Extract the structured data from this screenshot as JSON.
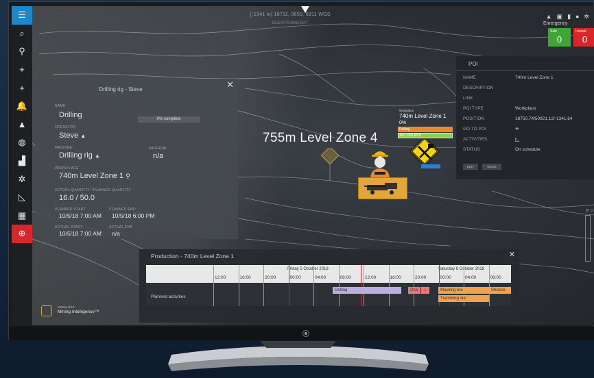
{
  "header": {
    "coordinates": "[-1341 m] 18711, 0650, 5811 WGS",
    "sub_coords": "ELEVATION/LIGHT"
  },
  "top_icons": [
    "warning-icon",
    "screen-icon",
    "battery-icon",
    "user-icon",
    "settings-icon"
  ],
  "emergency": {
    "title": "Emergency",
    "safe_label": "Safe",
    "safe_count": "0",
    "unsafe_label": "Unsafe",
    "unsafe_count": "0",
    "safe_color": "#3fa535",
    "unsafe_color": "#d8262b"
  },
  "sidebar": {
    "items": [
      {
        "name": "menu-icon",
        "glyph": "☰"
      },
      {
        "name": "search-icon",
        "glyph": "⌕"
      },
      {
        "name": "location-pin-icon",
        "glyph": "⚲"
      },
      {
        "name": "route-icon",
        "glyph": "⌖"
      },
      {
        "name": "add-icon",
        "glyph": "+"
      },
      {
        "name": "bell-icon",
        "glyph": "🔔"
      },
      {
        "name": "warning-icon",
        "glyph": "▲"
      },
      {
        "name": "globe-icon",
        "glyph": "◍"
      },
      {
        "name": "analytics-icon",
        "glyph": "▟"
      },
      {
        "name": "settings-icon",
        "glyph": "✲"
      },
      {
        "name": "chart-icon",
        "glyph": "◺"
      },
      {
        "name": "grid-icon",
        "glyph": "▦"
      },
      {
        "name": "alarm-icon",
        "glyph": "⊕"
      }
    ]
  },
  "drilling_panel": {
    "title": "Drilling rig - Steve",
    "name_label": "NAME",
    "name_value": "Drilling",
    "progress_text": "0% complete",
    "progress_fraction": 0,
    "operator_label": "OPERATOR",
    "operator_value": "Steve",
    "machine_label": "MACHINE",
    "machine_value": "Drilling rig",
    "material_label": "MATERIAL",
    "material_value": "n/a",
    "workplace_label": "WORKPLACE",
    "workplace_value": "740m Level Zone 1",
    "quantity_label": "ACTUAL QUANTITY / PLANNED QUANTITY",
    "quantity_value": "16.0 / 50.0",
    "planned_start_label": "PLANNED START",
    "planned_start_value": "10/5/18 7:00 AM",
    "planned_end_label": "PLANNED END",
    "planned_end_value": "10/5/18 6:00 PM",
    "actual_start_label": "ACTUAL START",
    "actual_start_value": "10/5/18 7:00 AM",
    "actual_end_label": "ACTUAL END",
    "actual_end_value": "n/a"
  },
  "poi_panel": {
    "title": "POI",
    "rows": [
      {
        "label": "NAME",
        "value": "740m Level Zone 1"
      },
      {
        "label": "DESCRIPTION",
        "value": ""
      },
      {
        "label": "LINK",
        "value": ""
      },
      {
        "label": "POI TYPE",
        "value": "Workplace"
      },
      {
        "label": "POSITION",
        "value": "18750.74/50921.12/-1341.64"
      },
      {
        "label": "GO TO POI",
        "value": ""
      },
      {
        "label": "ACTIVITIES",
        "value": ""
      },
      {
        "label": "STATUS",
        "value": "On schedule"
      }
    ],
    "edit_label": "EDIT",
    "move_label": "MOVE"
  },
  "map": {
    "zone_label": "755m Level Zone 4",
    "workplace_tag": "Workplace",
    "workplace_name": "740m Level Zone 1",
    "workplace_progress": "0%",
    "activity_bar": "Drilling",
    "delay_bar": "NO DELAYS",
    "scale_label": "87 m"
  },
  "production": {
    "title": "Production - 740m Level Zone 1",
    "days": [
      "Friday 5 October 2018",
      "Saturday 6 October 2018"
    ],
    "hours": [
      "12:00",
      "16:00",
      "20:00",
      "00:00",
      "04:00",
      "08:00",
      "12:00",
      "16:00",
      "20:00",
      "00:00",
      "04:00",
      "08:00"
    ],
    "row_label": "Planned activities",
    "tasks": [
      {
        "label": "Drilling",
        "color": "#b9b0e0"
      },
      {
        "label": "Cha",
        "color": "#e57a7a"
      },
      {
        "label": "Mucking ore",
        "color": "#f3a24a"
      },
      {
        "label": "Shotcre",
        "color": "#f3a24a"
      },
      {
        "label": "Tramming ore",
        "color": "#f3a24a"
      }
    ]
  },
  "brand": {
    "line1": "MOBILARIS",
    "line2": "Mining Intelligence™"
  }
}
